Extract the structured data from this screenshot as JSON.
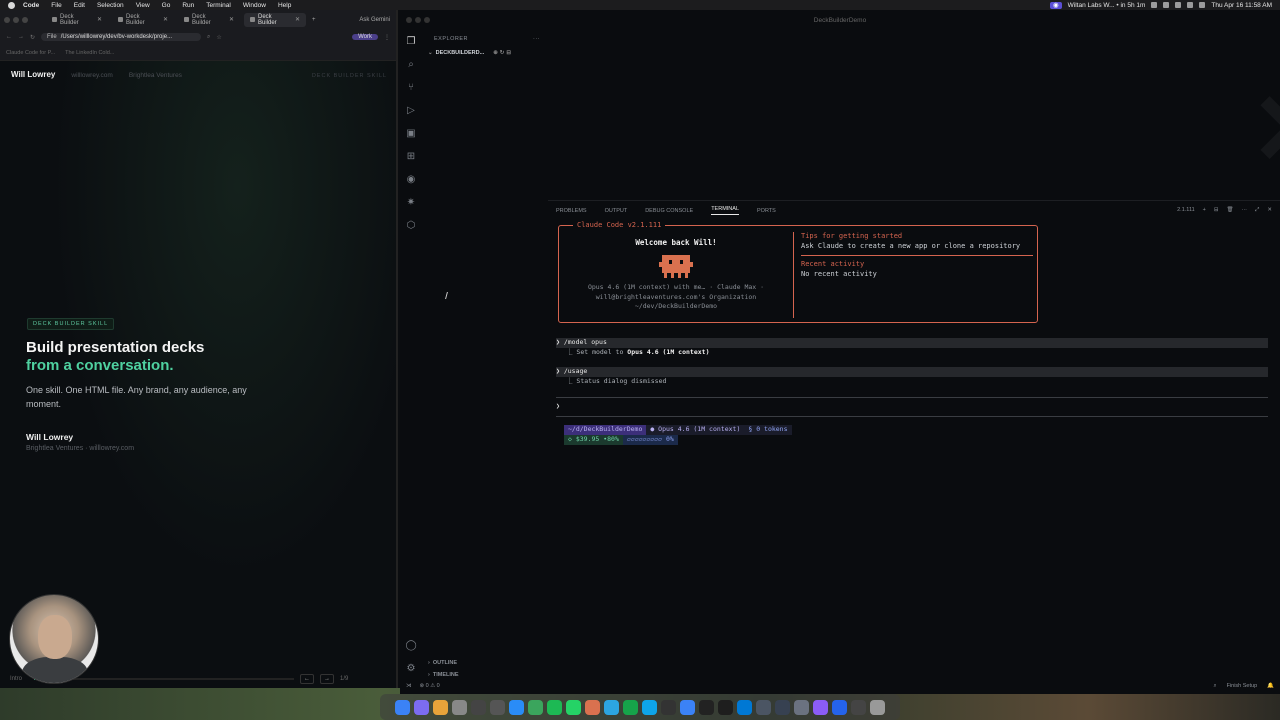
{
  "menubar": {
    "app": "Code",
    "items": [
      "File",
      "Edit",
      "Selection",
      "View",
      "Go",
      "Run",
      "Terminal",
      "Window",
      "Help"
    ],
    "status_chip": "Wiltan Labs W... • in 5h 1m",
    "clock": "Thu Apr 16  11:58 AM"
  },
  "browser": {
    "tabs": [
      "Deck Builder",
      "Deck Builder",
      "Deck Builder",
      "Deck Builder"
    ],
    "ask_gemini": "Ask Gemini",
    "url_scheme": "File",
    "url": "/Users/willlowrey/dev/bv-workdesk/proje...",
    "profile": "Work",
    "bookmarks": [
      "Claude Code for P...",
      "The LinkedIn Cold..."
    ]
  },
  "slide": {
    "author": "Will Lowrey",
    "site": "willlowrey.com",
    "company": "Brightlea Ventures",
    "skill_tag": "DECK BUILDER SKILL",
    "badge": "DECK BUILDER SKILL",
    "headline": "Build presentation decks",
    "headline_accent": "from a conversation.",
    "subtext": "One skill. One HTML file. Any brand, any audience, any moment.",
    "presenter": "Will Lowrey",
    "org": "Brightlea Ventures · willlowrey.com",
    "section": "Intro",
    "page": "1/9",
    "progress": 0.11
  },
  "vscode": {
    "title": "DeckBuilderDemo",
    "explorer_label": "EXPLORER",
    "project": "DECKBUILDERD...",
    "outline": "OUTLINE",
    "timeline": "TIMELINE",
    "panel_tabs": [
      "PROBLEMS",
      "OUTPUT",
      "DEBUG CONSOLE",
      "TERMINAL",
      "PORTS"
    ],
    "active_tab": "TERMINAL",
    "terminal_version": "2.1.111",
    "status_left": "⊗ 0  ⚠ 0",
    "status_right": "Finish Setup"
  },
  "claude": {
    "box_title": "Claude Code v2.1.111",
    "welcome": "Welcome back Will!",
    "model_line": "Opus 4.6 (1M context) with me… · Claude Max ·",
    "org_line": "will@brightleaventures.com's Organization",
    "path_line": "~/dev/DeckBuilderDemo",
    "tips_title": "Tips for getting started",
    "tips_text": "Ask Claude to create a new app or clone a repository",
    "recent_title": "Recent activity",
    "recent_text": "No recent activity",
    "cmd1": "❯ /model opus",
    "out1_prefix": "⎿  Set model to ",
    "out1_bold": "Opus 4.6 (1M context)",
    "cmd2": "❯ /usage",
    "out2": "⎿  Status dialog dismissed",
    "prompt": "❯",
    "status_path": "~/d/DeckBuilderDemo",
    "status_model": "● Opus 4.6 (1M context)",
    "status_tokens": "§ 0 tokens",
    "status_cost": "◇ $39.95 •80%",
    "status_ctx": "▱▱▱▱▱▱▱▱▱ 0%"
  }
}
